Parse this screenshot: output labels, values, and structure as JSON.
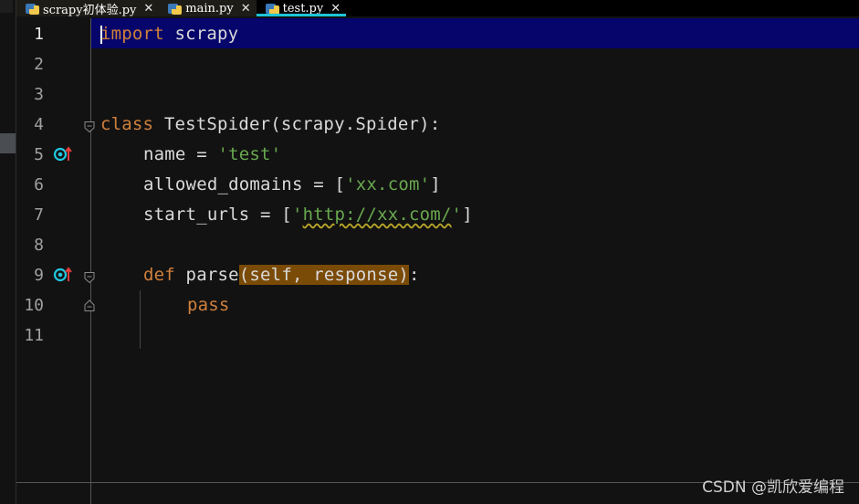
{
  "tabs": [
    {
      "label": "scrapy初体验.py",
      "active": false
    },
    {
      "label": "main.py",
      "active": false
    },
    {
      "label": "test.py",
      "active": true
    }
  ],
  "lines": [
    {
      "num": "1"
    },
    {
      "num": "2"
    },
    {
      "num": "3"
    },
    {
      "num": "4"
    },
    {
      "num": "5"
    },
    {
      "num": "6"
    },
    {
      "num": "7"
    },
    {
      "num": "8"
    },
    {
      "num": "9"
    },
    {
      "num": "10"
    },
    {
      "num": "11"
    }
  ],
  "code": {
    "l1_kw": "import",
    "l1_rest": " scrapy",
    "l4_kw": "class",
    "l4_rest": " TestSpider(scrapy.Spider):",
    "l5_a": "name = ",
    "l5_str": "'test'",
    "l6_a": "allowed_domains = [",
    "l6_str": "'xx.com'",
    "l6_b": "]",
    "l7_a": "start_urls = [",
    "l7_q1": "'",
    "l7_url": "http://xx.com/",
    "l7_q2": "'",
    "l7_b": "]",
    "l9_kw": "def",
    "l9_fn": " parse",
    "l9_args": "(self, response)",
    "l9_colon": ":",
    "l10_kw": "pass"
  },
  "colors": {
    "keyword": "#d0803c",
    "string": "#69a84f",
    "current_line": "#05056b",
    "tab_accent": "#1ec4d8",
    "param_highlight": "#7a4a07"
  },
  "watermark": "CSDN @凯欣爱编程"
}
